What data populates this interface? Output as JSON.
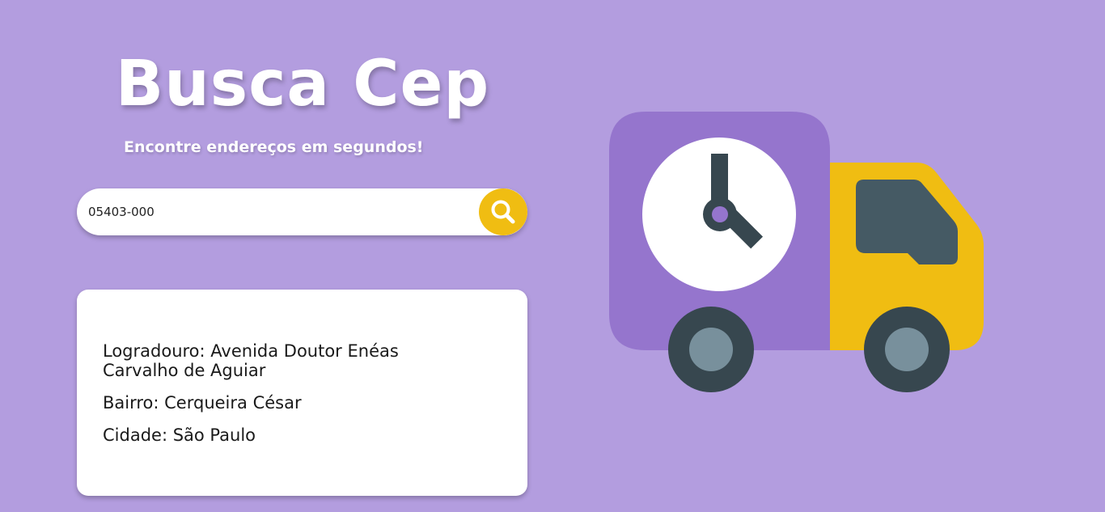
{
  "header": {
    "title": "Busca Cep",
    "subtitle": "Encontre endereços em segundos!"
  },
  "search": {
    "value": "05403-000",
    "button_icon": "search-icon",
    "button_color": "#f0bd12"
  },
  "result": {
    "logradouro": "Logradouro: Avenida Doutor Enéas Carvalho de Aguiar",
    "bairro": "Bairro: Cerqueira César",
    "cidade": "Cidade: São Paulo"
  },
  "illustration": {
    "icon": "delivery-truck-clock-icon"
  },
  "colors": {
    "background": "#b39ddf",
    "accent": "#f0bd12",
    "truck_body": "#9575cd",
    "truck_dark": "#37474f"
  }
}
